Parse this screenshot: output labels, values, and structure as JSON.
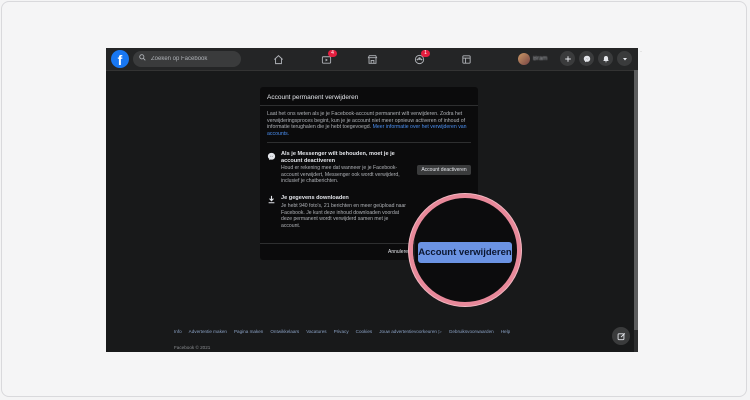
{
  "colors": {
    "fb_blue": "#1877f2",
    "accent_button": "#6b93e3",
    "highlight_ring": "#e8899a",
    "background_dark": "#18191a"
  },
  "topbar": {
    "logo": "f",
    "search_placeholder": "Zoeken op Facebook",
    "nav_icons": [
      "home-icon",
      "watch-icon",
      "marketplace-icon",
      "groups-icon",
      "gaming-icon"
    ],
    "watch_badge": "4",
    "groups_badge": "1",
    "profile_name": "Bram",
    "right_icons": [
      "plus-icon",
      "messenger-icon",
      "bell-icon",
      "caret-down-icon"
    ]
  },
  "modal": {
    "title": "Account permanent verwijderen",
    "intro": "Laat het ons weten als je je Facebook-account permanent wilt verwijderen. Zodra het verwijderingsproces begint, kun je je account niet meer opnieuw activeren of inhoud of informatie terughalen die je hebt toegevoegd.",
    "intro_link": "Meer informatie over het verwijderen van accounts.",
    "messenger_title": "Als je Messenger wilt behouden, moet je je account deactiveren",
    "messenger_text": "Houd er rekening mee dat wanneer je je Facebook-account verwijdert, Messenger ook wordt verwijderd, inclusief je chatberichten.",
    "deactivate_button": "Account deactiveren",
    "download_title": "Je gegevens downloaden",
    "download_text": "Je hebt 940 foto's, 21 berichten en meer geüpload naar Facebook. Je kunt deze inhoud downloaden voordat deze permanent wordt verwijderd samen met je account.",
    "cancel_button": "Annuleren"
  },
  "zoom": {
    "delete_button": "Account verwijderen"
  },
  "footer": {
    "links": [
      "Info",
      "Advertentie maken",
      "Pagina maken",
      "Ontwikkelaars",
      "Vacatures",
      "Privacy",
      "Cookies",
      "Jouw advertentievoorkeuren ▷",
      "Gebruiksvoorwaarden",
      "Help"
    ],
    "copyright": "Facebook © 2021"
  }
}
